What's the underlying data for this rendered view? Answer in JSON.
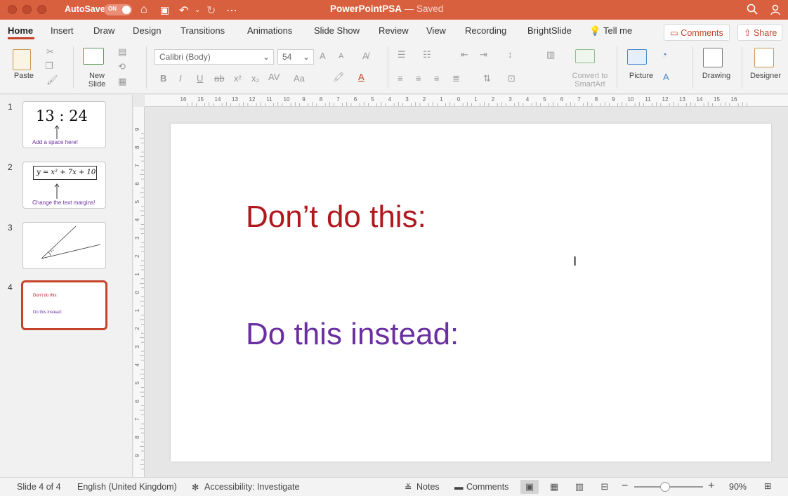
{
  "titlebar": {
    "autosave_label": "AutoSave",
    "autosave_state": "ON",
    "doc_name": "PowerPointPSA",
    "doc_status": " — Saved"
  },
  "tabs": [
    {
      "label": "Home",
      "active": true
    },
    {
      "label": "Insert"
    },
    {
      "label": "Draw"
    },
    {
      "label": "Design"
    },
    {
      "label": "Transitions"
    },
    {
      "label": "Animations"
    },
    {
      "label": "Slide Show"
    },
    {
      "label": "Review"
    },
    {
      "label": "View"
    },
    {
      "label": "Recording"
    },
    {
      "label": "BrightSlide"
    },
    {
      "label": "Tell me"
    }
  ],
  "header_buttons": {
    "comments": "Comments",
    "share": "Share"
  },
  "ribbon": {
    "paste": "Paste",
    "new_slide_line1": "New",
    "new_slide_line2": "Slide",
    "font_name": "Calibri (Body)",
    "font_size": "54",
    "convert_line1": "Convert to",
    "convert_line2": "SmartArt",
    "picture": "Picture",
    "drawing": "Drawing",
    "designer": "Designer"
  },
  "thumbnails": [
    {
      "num": "1",
      "time": "13 : 24",
      "note": "Add a space here!"
    },
    {
      "num": "2",
      "equation": "y = x² + 7x + 10",
      "note": "Change the text margins!"
    },
    {
      "num": "3",
      "angle_label": "x°"
    },
    {
      "num": "4",
      "line1": "Don’t do this:",
      "line2": "Do this instead:",
      "selected": true
    }
  ],
  "slide": {
    "line1": "Don’t do this:",
    "line2": "Do this instead:",
    "line1_color": "#b0181d",
    "line2_color": "#6a2fa0"
  },
  "ruler": {
    "horizontal": [
      "16",
      "15",
      "14",
      "13",
      "12",
      "11",
      "10",
      "9",
      "8",
      "7",
      "6",
      "5",
      "4",
      "3",
      "2",
      "1",
      "0",
      "1",
      "2",
      "3",
      "4",
      "5",
      "6",
      "7",
      "8",
      "9",
      "10",
      "11",
      "12",
      "13",
      "14",
      "15",
      "16"
    ],
    "vertical": [
      "9",
      "8",
      "7",
      "6",
      "5",
      "4",
      "3",
      "2",
      "1",
      "0",
      "1",
      "2",
      "3",
      "4",
      "5",
      "6",
      "7",
      "8",
      "9"
    ]
  },
  "statusbar": {
    "slide_info": "Slide 4 of 4",
    "language": "English (United Kingdom)",
    "accessibility": "Accessibility: Investigate",
    "notes": "Notes",
    "comments": "Comments",
    "zoom": "90%",
    "zoom_level": 0.45
  },
  "colors": {
    "accent": "#c4432a",
    "titlebar": "#d9603f"
  }
}
